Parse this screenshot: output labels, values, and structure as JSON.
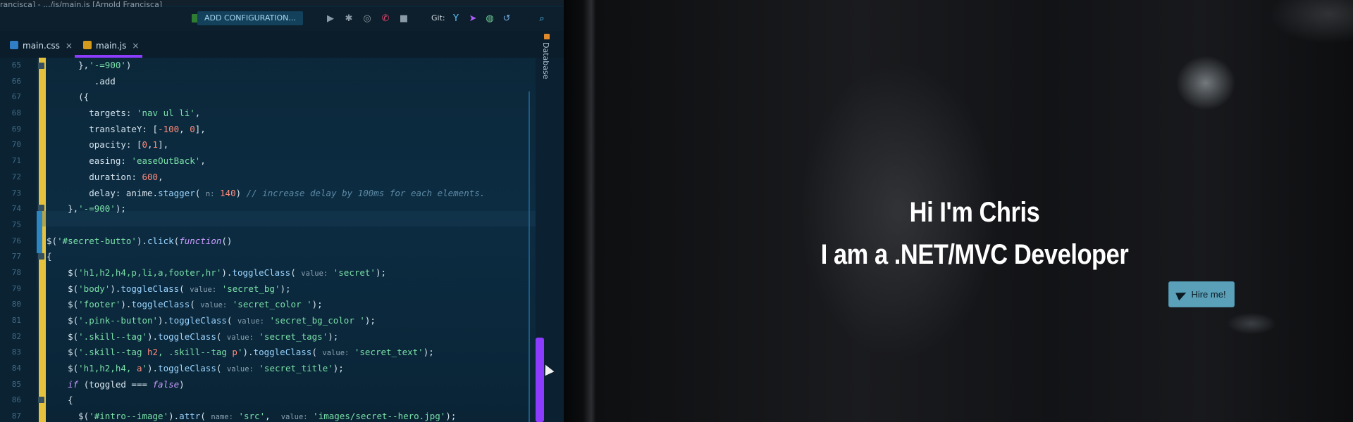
{
  "ide": {
    "title": "rancisca] - .../js/main.js [Arnold Francisca]",
    "run_config": "ADD CONFIGURATION...",
    "git_label": "Git:",
    "tabs": [
      {
        "label": "main.css",
        "close": "×"
      },
      {
        "label": "main.js",
        "close": "×"
      }
    ],
    "side_panel": "Database",
    "line_numbers": [
      "65",
      "66",
      "67",
      "68",
      "69",
      "70",
      "71",
      "72",
      "73",
      "74",
      "75",
      "76",
      "77",
      "78",
      "79",
      "80",
      "81",
      "82",
      "83",
      "84",
      "85",
      "86",
      "87"
    ]
  },
  "hero": {
    "line1": "Hi I'm Chris",
    "line2": "I am a .NET/MVC Developer",
    "button_label": "Hire me!",
    "button_color": "#5ba0b9"
  }
}
